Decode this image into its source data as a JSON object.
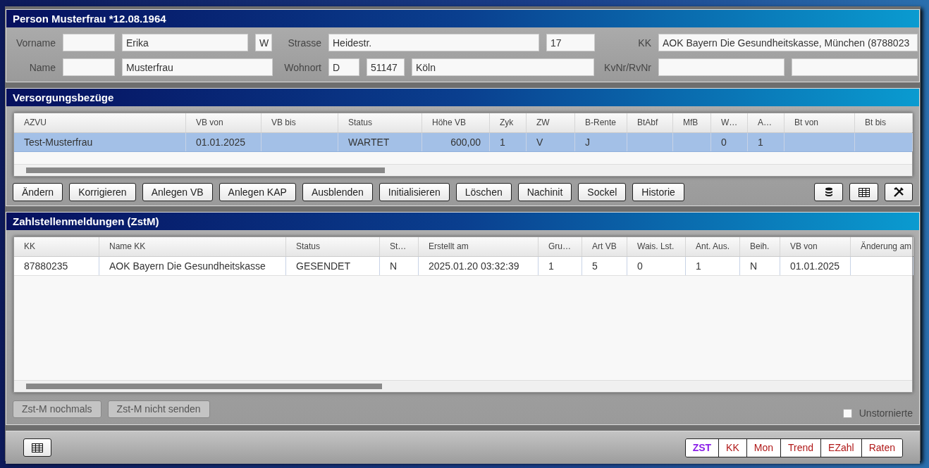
{
  "person": {
    "title": "Person Musterfrau *12.08.1964",
    "groups": [
      {
        "rows": [
          [
            {
              "kind": "label",
              "text": "Vorname"
            },
            {
              "kind": "field"
            },
            {
              "kind": "field",
              "value": "Erika"
            },
            {
              "kind": "field",
              "value": "W"
            }
          ],
          [
            {
              "kind": "label",
              "text": "Name"
            },
            {
              "kind": "field"
            },
            {
              "kind": "field",
              "value": "Musterfrau"
            }
          ]
        ]
      },
      {
        "rows": [
          [
            {
              "kind": "label",
              "text": "Strasse"
            },
            {
              "kind": "field",
              "value": "Heidestr."
            },
            {
              "kind": "field",
              "value": "17"
            }
          ],
          [
            {
              "kind": "label",
              "text": "Wohnort"
            },
            {
              "kind": "field",
              "value": "D"
            },
            {
              "kind": "field",
              "value": "51147"
            },
            {
              "kind": "field",
              "value": "Köln"
            }
          ]
        ]
      },
      {
        "rows": [
          [
            {
              "kind": "label",
              "text": "KK"
            },
            {
              "kind": "field",
              "value": "AOK Bayern Die Gesundheitskasse, München (8788023"
            }
          ],
          [
            {
              "kind": "label",
              "text": "KvNr/RvNr"
            },
            {
              "kind": "field"
            },
            {
              "kind": "field"
            }
          ]
        ]
      }
    ]
  },
  "versorgung": {
    "title": "Versorgungsbezüge",
    "columns": [
      "AZVU",
      "VB von",
      "VB bis",
      "Status",
      "Höhe VB",
      "Zyk",
      "ZW",
      "B-Rente",
      "BtAbf",
      "MfB",
      "W…",
      "A…",
      "Bt von",
      "Bt bis"
    ],
    "rows": [
      {
        "selected": true,
        "cells": [
          "Test-Musterfrau",
          "01.01.2025",
          "",
          "WARTET",
          "600,00",
          "1",
          "V",
          "J",
          "",
          "",
          "0",
          "1",
          "",
          ""
        ]
      }
    ],
    "buttons": [
      "Ändern",
      "Korrigieren",
      "Anlegen VB",
      "Anlegen KAP",
      "Ausblenden",
      "Initialisieren",
      "Löschen",
      "Nachinit",
      "Sockel",
      "Historie"
    ]
  },
  "zstm": {
    "title": "Zahlstellenmeldungen (ZstM)",
    "columns": [
      "KK",
      "Name KK",
      "Status",
      "St…",
      "Erstellt am",
      "Gru…",
      "Art VB",
      "Wais. Lst.",
      "Ant. Aus.",
      "Beih.",
      "VB von",
      "Änderung am"
    ],
    "rows": [
      {
        "selected": false,
        "cells": [
          "87880235",
          "AOK Bayern Die Gesundheitskasse",
          "GESENDET",
          "N",
          "2025.01.20 03:32:39",
          "1",
          "5",
          "0",
          "1",
          "N",
          "01.01.2025",
          ""
        ]
      }
    ],
    "buttons": [
      {
        "label": "Zst-M nochmals",
        "disabled": true
      },
      {
        "label": "Zst-M nicht senden",
        "disabled": true
      }
    ],
    "checkbox": {
      "label": "Unstornierte",
      "checked": false
    }
  },
  "segments": [
    {
      "label": "ZST",
      "selected": true
    },
    {
      "label": "KK",
      "selected": false
    },
    {
      "label": "Mon",
      "selected": false
    },
    {
      "label": "Trend",
      "selected": false
    },
    {
      "label": "EZahl",
      "selected": false
    },
    {
      "label": "Raten",
      "selected": false
    }
  ]
}
